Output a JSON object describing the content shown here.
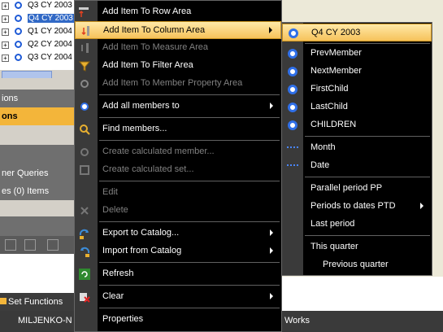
{
  "tree": {
    "rows": [
      {
        "label": "Q3 CY 2003",
        "selected": false
      },
      {
        "label": "Q4 CY 2003",
        "selected": true
      },
      {
        "label": "Q1 CY 2004",
        "selected": false
      },
      {
        "label": "Q2 CY 2004",
        "selected": false
      },
      {
        "label": "Q3 CY 2004",
        "selected": false
      }
    ]
  },
  "panels": {
    "p1": "ions",
    "p2": "ons",
    "p3": "ner Queries",
    "p4": "es (0) Items"
  },
  "bottom": {
    "tab_label": "Set Functions",
    "taskbar_left": "MILJENKO-N",
    "taskbar_right": "Works"
  },
  "menu": {
    "items": [
      {
        "label": "Add Item To Row Area",
        "icon": "add-row-icon",
        "disabled": false,
        "submenu": false
      },
      {
        "label": "Add Item To Column Area",
        "icon": "add-column-icon",
        "disabled": false,
        "submenu": true,
        "highlighted": true
      },
      {
        "label": "Add Item To Measure Area",
        "icon": "add-measure-icon",
        "disabled": true,
        "submenu": false
      },
      {
        "label": "Add Item To Filter Area",
        "icon": "add-filter-icon",
        "disabled": false,
        "submenu": false
      },
      {
        "label": "Add Item To Member Property Area",
        "icon": "member-property-icon",
        "disabled": true,
        "submenu": false
      },
      {
        "label": "Add all members to",
        "icon": "add-all-icon",
        "disabled": false,
        "submenu": true
      },
      {
        "label": "Find members...",
        "icon": "find-icon",
        "disabled": false,
        "submenu": false
      },
      {
        "label": "Create calculated member...",
        "icon": "calc-member-icon",
        "disabled": true,
        "submenu": false
      },
      {
        "label": "Create calculated set...",
        "icon": "calc-set-icon",
        "disabled": true,
        "submenu": false
      },
      {
        "label": "Edit",
        "icon": "",
        "disabled": true,
        "submenu": false
      },
      {
        "label": "Delete",
        "icon": "delete-icon",
        "disabled": true,
        "submenu": false
      },
      {
        "label": "Export to Catalog...",
        "icon": "export-icon",
        "disabled": false,
        "submenu": true
      },
      {
        "label": "Import from Catalog",
        "icon": "import-icon",
        "disabled": false,
        "submenu": true
      },
      {
        "label": "Refresh",
        "icon": "refresh-icon",
        "disabled": false,
        "submenu": false
      },
      {
        "label": "Clear",
        "icon": "clear-icon",
        "disabled": false,
        "submenu": true
      },
      {
        "label": "Properties",
        "icon": "",
        "disabled": false,
        "submenu": false
      }
    ]
  },
  "submenu": {
    "items": [
      {
        "label": "Q4 CY 2003",
        "icon": "member-icon",
        "highlighted": true
      },
      {
        "label": "PrevMember",
        "icon": "member-icon"
      },
      {
        "label": "NextMember",
        "icon": "member-icon"
      },
      {
        "label": "FirstChild",
        "icon": "member-icon"
      },
      {
        "label": "LastChild",
        "icon": "member-icon"
      },
      {
        "label": "CHILDREN",
        "icon": "member-icon"
      },
      {
        "label": "Month",
        "icon": "level-icon"
      },
      {
        "label": "Date",
        "icon": "level-icon"
      },
      {
        "label": "Parallel period PP",
        "icon": ""
      },
      {
        "label": "Periods to dates PTD",
        "icon": "",
        "submenu": true
      },
      {
        "label": "Last period",
        "icon": ""
      },
      {
        "label": "This quarter",
        "icon": ""
      },
      {
        "label": "Previous quarter",
        "icon": ""
      }
    ]
  }
}
